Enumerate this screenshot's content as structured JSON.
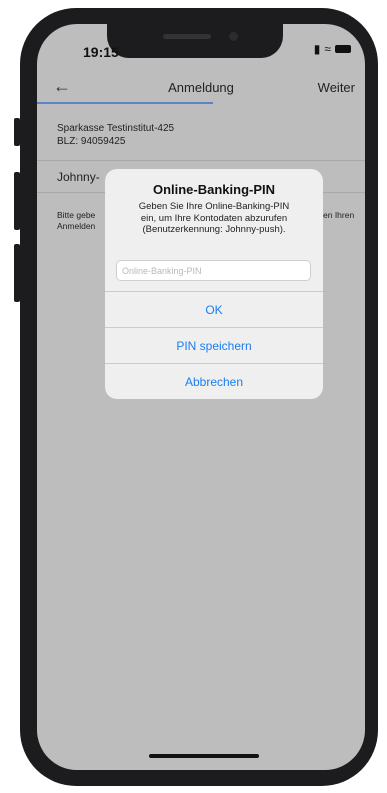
{
  "status_bar": {
    "time": "19:15",
    "signal_icon": "signal-icon",
    "wifi_icon": "wifi-icon",
    "battery_icon": "battery-icon"
  },
  "navbar": {
    "back_icon": "arrow-left-icon",
    "back_glyph": "←",
    "title": "Anmeldung",
    "next_label": "Weiter",
    "accent_color": "#5a84c8"
  },
  "bank": {
    "name": "Sparkasse Testinstitut-425",
    "blz": "BLZ: 94059425"
  },
  "user": {
    "name_partial": "Johnny-"
  },
  "hint": {
    "line1": "Bitte gebe",
    "line2": "Anmelden",
    "right": "en Ihren"
  },
  "dialog": {
    "title": "Online-Banking-PIN",
    "message_line1": "Geben Sie Ihre Online-Banking-PIN",
    "message_line2": "ein, um Ihre Kontodaten abzurufen",
    "message_line3": "(Benutzerkennung: Johnny-push).",
    "input_placeholder": "Online-Banking-PIN",
    "input_value": "",
    "ok_label": "OK",
    "save_label": "PIN speichern",
    "cancel_label": "Abbrechen",
    "button_color": "#1a7ef0"
  }
}
